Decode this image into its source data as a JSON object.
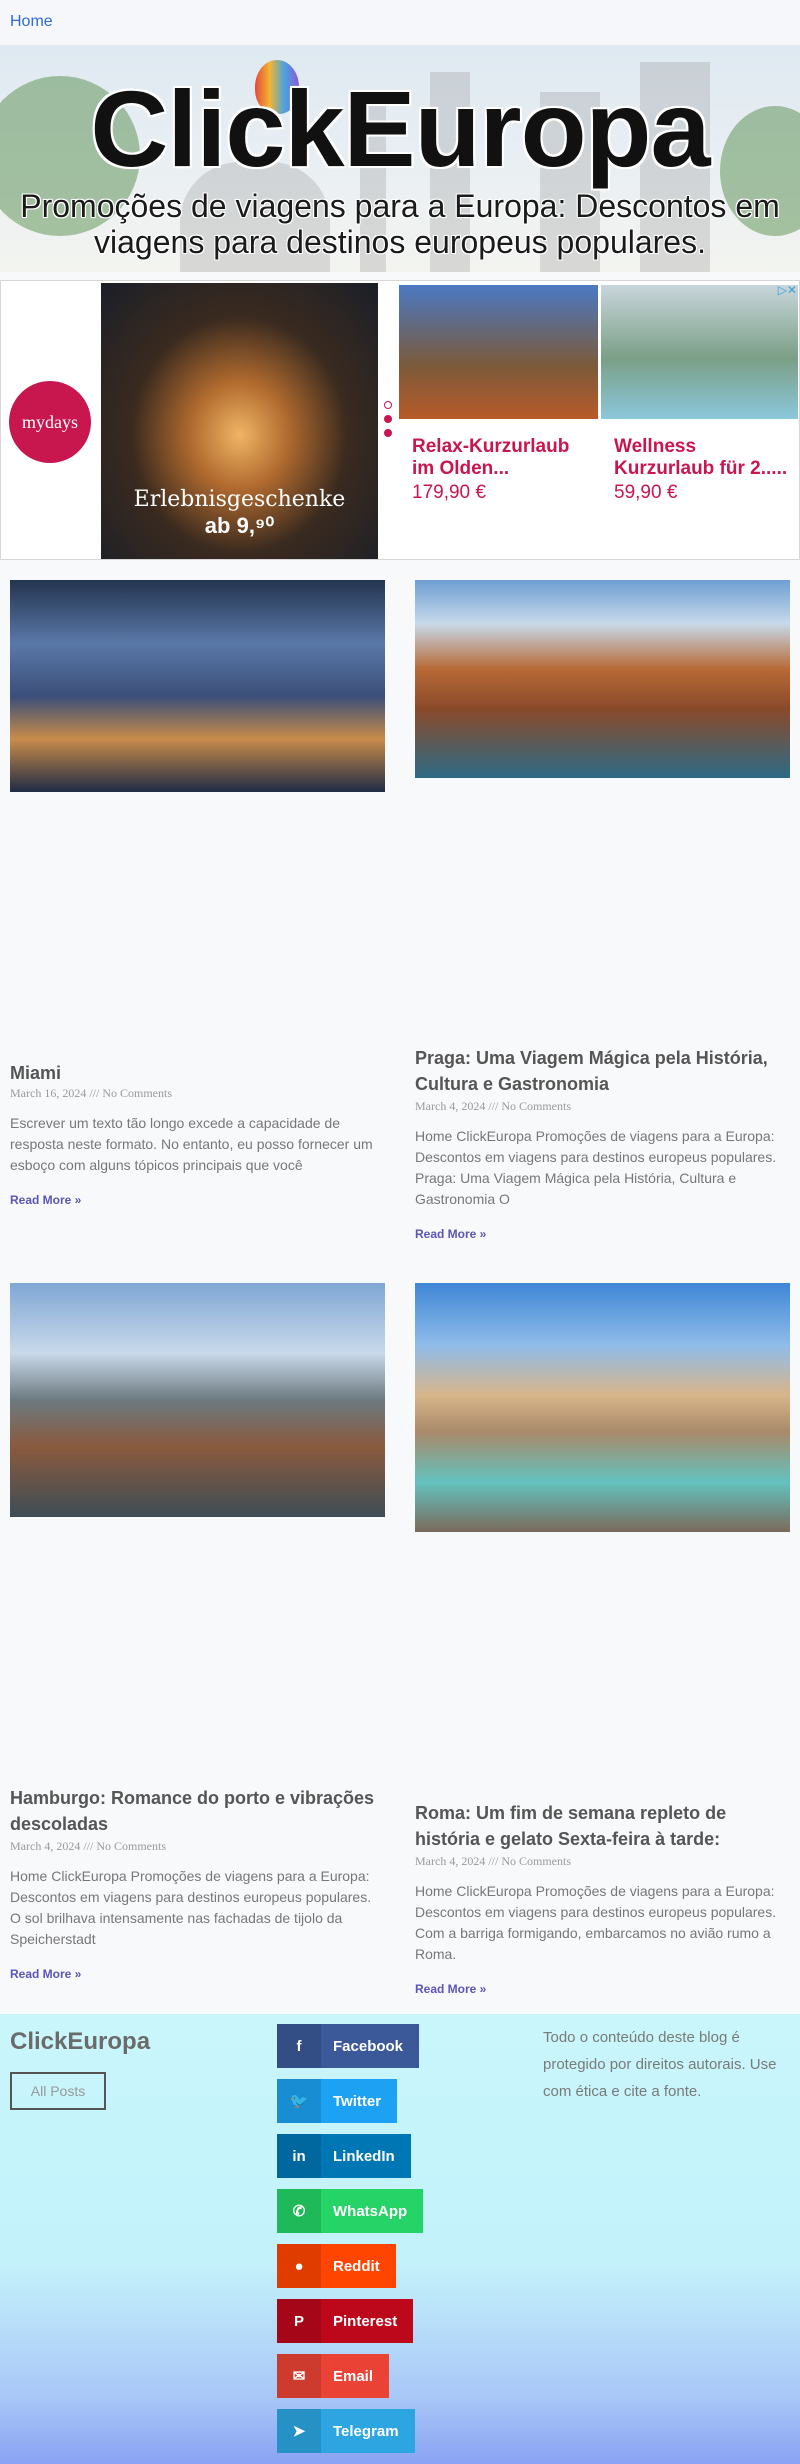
{
  "nav": {
    "home": "Home"
  },
  "hero": {
    "title": "ClickEuropa",
    "subtitle": "Promoções de viagens para a Europa: Descontos em viagens para destinos europeus populares."
  },
  "ad": {
    "brand": "mydays",
    "tagline_1": "Erlebnisgeschenke",
    "tagline_2": "ab 9,⁹⁰",
    "offers": [
      {
        "title": "Relax-Kurzurlaub im Olden...",
        "price": "179,90 €"
      },
      {
        "title": "Wellness Kurzurlaub für 2.....",
        "price": "59,90 €"
      }
    ],
    "choices_icon": "adchoices-icon",
    "accent": "#c8164f"
  },
  "posts": [
    {
      "title": "Miami",
      "meta": "March 16, 2024 /// No Comments",
      "excerpt": "Escrever um texto tão longo excede a capacidade de resposta neste formato. No entanto, eu posso fornecer um esboço com alguns tópicos principais que você",
      "read_more": "Read More »"
    },
    {
      "title": "Praga: Uma Viagem Mágica pela História, Cultura e Gastronomia",
      "meta": "March 4, 2024 /// No Comments",
      "excerpt": "Home ClickEuropa Promoções de viagens para a Europa: Descontos em viagens para destinos europeus populares. Praga: Uma Viagem Mágica pela História, Cultura e Gastronomia O",
      "read_more": "Read More »"
    },
    {
      "title": "Hamburgo: Romance do porto e vibrações descoladas",
      "meta": "March 4, 2024 /// No Comments",
      "excerpt": "Home ClickEuropa Promoções de viagens para a Europa: Descontos em viagens para destinos europeus populares. O sol brilhava intensamente nas fachadas de tijolo da Speicherstadt",
      "read_more": "Read More »"
    },
    {
      "title": "Roma: Um fim de semana repleto de história e gelato Sexta-feira à tarde:",
      "meta": "March 4, 2024 /// No Comments",
      "excerpt": "Home ClickEuropa Promoções de viagens para a Europa: Descontos em viagens para destinos europeus populares. Com a barriga formigando, embarcamos no avião rumo a Roma.",
      "read_more": "Read More »"
    }
  ],
  "footer": {
    "brand": "ClickEuropa",
    "all_posts": "All Posts",
    "copyright": "Todo o conteúdo deste blog é protegido por direitos autorais. Use com ética e cite a fonte.",
    "share": [
      {
        "label": "Facebook",
        "icon": "facebook-icon",
        "color": "#3b5998"
      },
      {
        "label": "Twitter",
        "icon": "twitter-icon",
        "color": "#1da1f2"
      },
      {
        "label": "LinkedIn",
        "icon": "linkedin-icon",
        "color": "#0077b5"
      },
      {
        "label": "WhatsApp",
        "icon": "whatsapp-icon",
        "color": "#25d366"
      },
      {
        "label": "Reddit",
        "icon": "reddit-icon",
        "color": "#ff4500"
      },
      {
        "label": "Pinterest",
        "icon": "pinterest-icon",
        "color": "#bd081c"
      },
      {
        "label": "Email",
        "icon": "email-icon",
        "color": "#ea4335"
      },
      {
        "label": "Telegram",
        "icon": "telegram-icon",
        "color": "#2ca5e0"
      }
    ]
  }
}
